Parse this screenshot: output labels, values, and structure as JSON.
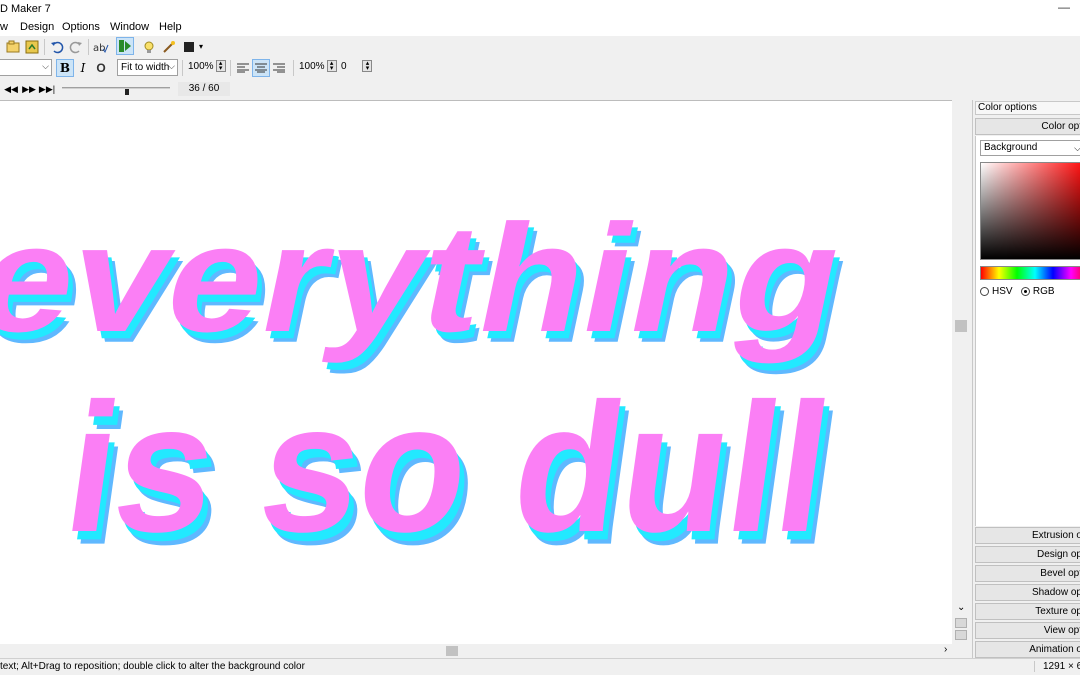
{
  "window": {
    "title": "D Maker 7",
    "minimize_glyph": "—"
  },
  "menu": [
    {
      "label": "w"
    },
    {
      "label": "Design"
    },
    {
      "label": "Options"
    },
    {
      "label": "Window"
    },
    {
      "label": "Help"
    }
  ],
  "toolbar": {
    "icons": [
      "open-file-icon",
      "save-file-icon",
      "undo-icon",
      "redo-icon",
      "spell-check-icon",
      "preview-icon",
      "light-bulb-icon",
      "wand-icon",
      "fill-icon"
    ],
    "font_select": "",
    "bold_label": "B",
    "italic_label": "I",
    "outline_label": "O",
    "fit_select": "Fit to width",
    "scale_value": "100%",
    "spacing_value": "100%",
    "offset_value": "0",
    "frame_counter": "36 / 60",
    "frame_progress": 0.6
  },
  "canvas": {
    "lines": [
      "everything",
      "is so dull"
    ],
    "text_color": "#fb7ff5",
    "extrusion_color": "#22e9ff",
    "background_color": "#ffffff"
  },
  "panel": {
    "title": "Color options",
    "header": "Color opt",
    "target_select": "Background",
    "mode_hsv": "HSV",
    "mode_rgb": "RGB",
    "sections": [
      "Extrusion o",
      "Design op",
      "Bevel opt",
      "Shadow op",
      "Texture op",
      "View opt",
      "Animation o"
    ]
  },
  "status": {
    "message": "text; Alt+Drag to reposition; double click to alter the background color",
    "dimensions": "1291 × 6"
  }
}
